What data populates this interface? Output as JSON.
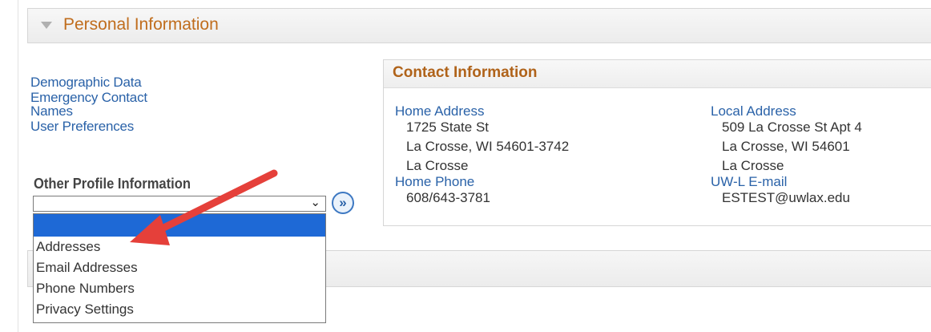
{
  "section": {
    "title": "Personal Information"
  },
  "links": [
    "Demographic Data",
    "Emergency Contact",
    "Names",
    "User Preferences"
  ],
  "other_profile": {
    "label": "Other Profile Information",
    "selected": "",
    "go_icon": "»",
    "options": [
      "",
      "Addresses",
      "Email Addresses",
      "Phone Numbers",
      "Privacy Settings"
    ]
  },
  "contact": {
    "title": "Contact Information",
    "home_address_label": "Home Address",
    "home_address_lines": [
      "1725 State St",
      "La Crosse, WI 54601-3742",
      "La Crosse"
    ],
    "home_phone_label": "Home Phone",
    "home_phone": "608/643-3781",
    "local_address_label": "Local Address",
    "local_address_lines": [
      "509 La Crosse St Apt 4",
      "La Crosse, WI 54601",
      "La Crosse"
    ],
    "email_label": "UW-L E-mail",
    "email": "ESTEST@uwlax.edu"
  },
  "colors": {
    "section_title": "#c06d1d",
    "link": "#2a62a8",
    "highlight": "#1e69d6",
    "arrow": "#e5403a"
  }
}
